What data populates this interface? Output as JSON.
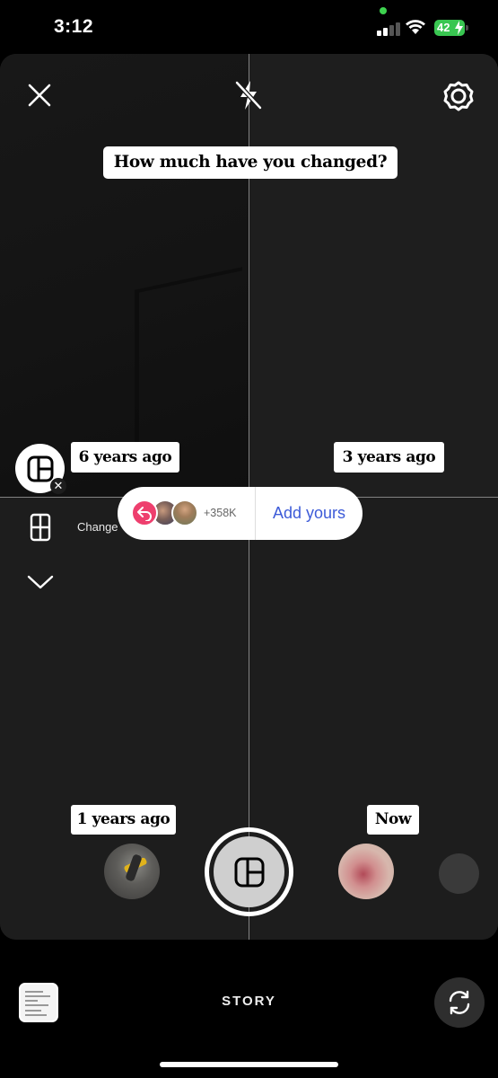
{
  "status_bar": {
    "time": "3:12",
    "battery": "42",
    "battery_color": "#39c651",
    "icons": [
      "signal-icon",
      "wifi-icon",
      "battery-charging-icon"
    ]
  },
  "camera": {
    "top_bar_icons": [
      "close-icon",
      "flash-off-icon",
      "settings-icon"
    ],
    "prompt": "How much have you changed?",
    "labels": {
      "top_left": "6 years ago",
      "top_right": "3 years ago",
      "bottom_left": "1 years ago",
      "bottom_right": "Now"
    },
    "side_tools": {
      "layout_icon": "layout-grid-icon",
      "change_label": "Change",
      "grid_icon": "grid-icon",
      "more_icon": "chevron-down-icon"
    },
    "add_yours": {
      "count": "+358K",
      "label": "Add yours",
      "accent_color": "#3d5bd8",
      "reply_color": "#ee3f6e"
    },
    "capture_row": {
      "effects": [
        "boomerang-icon",
        "effect-thumbnail-1",
        "effect-thumbnail-2",
        "effect-thumbnail-3"
      ],
      "shutter_icon": "layout-icon"
    }
  },
  "bottom_bar": {
    "mode": "STORY",
    "gallery_icon": "gallery-thumbnail",
    "flip_icon": "flip-camera-icon"
  }
}
